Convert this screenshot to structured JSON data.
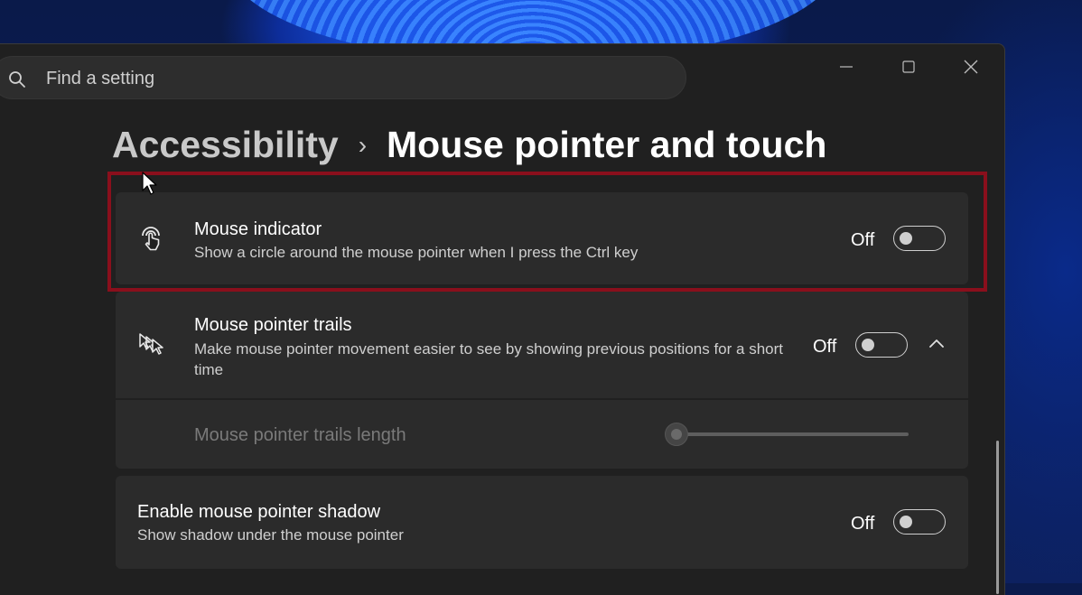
{
  "search": {
    "placeholder": "Find a setting"
  },
  "breadcrumb": {
    "parent": "Accessibility",
    "separator": "›",
    "current": "Mouse pointer and touch"
  },
  "settings": {
    "mouse_indicator": {
      "title": "Mouse indicator",
      "description": "Show a circle around the mouse pointer when I press the Ctrl key",
      "state": "Off",
      "icon": "touch-indicator-icon"
    },
    "pointer_trails": {
      "title": "Mouse pointer trails",
      "description": "Make mouse pointer movement easier to see by showing previous positions for a short time",
      "state": "Off",
      "icon": "pointer-trails-icon",
      "length_label": "Mouse pointer trails length",
      "length_value": 0
    },
    "pointer_shadow": {
      "title": "Enable mouse pointer shadow",
      "description": "Show shadow under the mouse pointer",
      "state": "Off"
    }
  },
  "colors": {
    "highlight": "#8a0f1c",
    "window_bg": "#202020",
    "card_bg": "#2b2b2b"
  }
}
